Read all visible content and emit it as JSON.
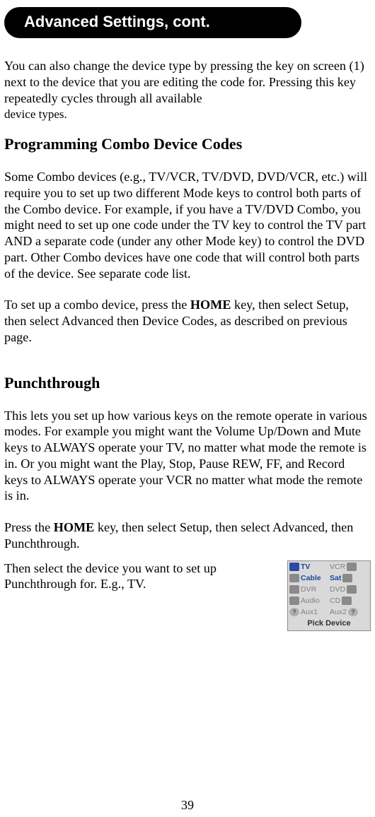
{
  "header": {
    "title": "Advanced Settings, cont."
  },
  "p1a": "You can also change the device type by pressing the key on screen (1) next to the device that you are editing the code for. Pressing this key repeatedly cycles through all available ",
  "p1b": "device types.",
  "h_combo": "Programming Combo Device Codes",
  "p2": "Some Combo devices (e.g., TV/VCR, TV/DVD, DVD/VCR, etc.) will require you to set up two different Mode keys to control both parts of the Combo device. For example, if you have a TV/DVD Combo, you might need to set up one code under the TV key to control the TV part AND a separate code (under any other Mode key) to control the DVD part. Other Combo devices have one code that will control both parts of the device. See separate code list.",
  "p3a": "To set up a combo device, press the ",
  "p3_home": "HOME",
  "p3b": " key, then select Setup, then select Advanced then Device Codes, as described on previous page.",
  "h_punch": "Punchthrough",
  "p4": "This lets you set up how various keys on the remote operate in various modes. For example you might want the Volume Up/Down and Mute keys to ALWAYS operate your TV, no matter what mode the remote is in. Or you might want the Play, Stop, Pause REW, FF, and Record keys to ALWAYS operate your VCR no matter what mode the remote is in.",
  "p5a": "Press the ",
  "p5_home": "HOME",
  "p5b": " key, then select Setup, then select Advanced, then Punchthrough.",
  "p6": "Then select the device you want to set up Punchthrough for. E.g., TV.",
  "devices": {
    "tv": "TV",
    "vcr": "VCR",
    "cable": "Cable",
    "sat": "Sat",
    "dvr": "DVR",
    "dvd": "DVD",
    "audio": "Audio",
    "cd": "CD",
    "aux1": "Aux1",
    "aux2": "Aux2",
    "footer": "Pick Device",
    "q": "?"
  },
  "page_number": "39"
}
